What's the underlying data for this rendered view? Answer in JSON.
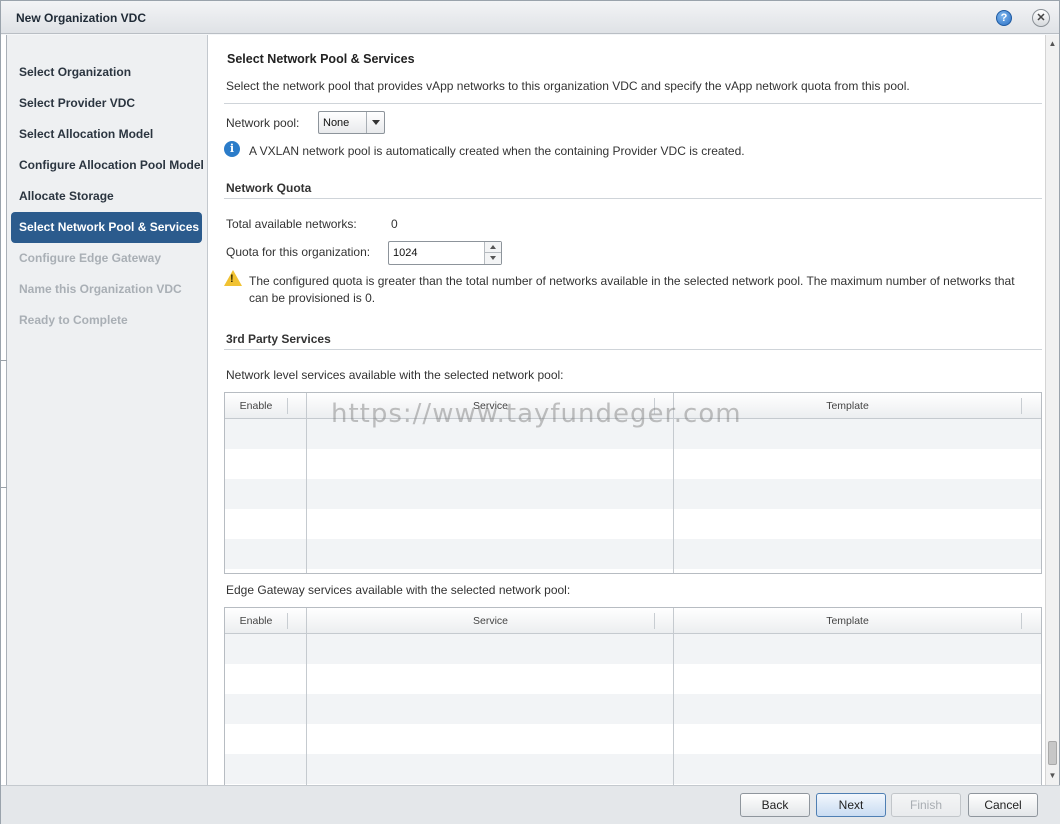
{
  "window": {
    "title": "New Organization VDC",
    "help_icon": "?",
    "close_icon": "✕"
  },
  "steps": [
    {
      "label": "Select Organization",
      "state": "done"
    },
    {
      "label": "Select Provider VDC",
      "state": "done"
    },
    {
      "label": "Select Allocation Model",
      "state": "done"
    },
    {
      "label": "Configure Allocation Pool Model",
      "state": "done"
    },
    {
      "label": "Allocate Storage",
      "state": "done"
    },
    {
      "label": "Select Network Pool & Services",
      "state": "active"
    },
    {
      "label": "Configure Edge Gateway",
      "state": "disabled"
    },
    {
      "label": "Name this Organization VDC",
      "state": "disabled"
    },
    {
      "label": "Ready to Complete",
      "state": "disabled"
    }
  ],
  "page": {
    "heading": "Select Network Pool & Services",
    "description": "Select the network pool that provides vApp networks to this organization VDC and specify the vApp network quota from this pool."
  },
  "network_pool": {
    "label": "Network pool:",
    "selected": "None",
    "info_text": "A VXLAN network pool is automatically created when the containing Provider VDC is created."
  },
  "quota": {
    "section_title": "Network Quota",
    "total_label": "Total available networks:",
    "total_value": "0",
    "quota_label": "Quota for this organization:",
    "quota_value": "1024",
    "warning_line1": "The configured quota is greater than the total number of networks available in the selected network pool.  The maximum number of networks that",
    "warning_line2": "can be provisioned is 0."
  },
  "services": {
    "section_title": "3rd Party Services",
    "network_label": "Network level services available with the selected network pool:",
    "network_columns": [
      "Enable",
      "Service",
      "Template"
    ],
    "edge_label": "Edge Gateway services available with the selected network pool:",
    "edge_columns": [
      "Enable",
      "Service",
      "Template"
    ]
  },
  "watermark": "https://www.tayfundeger.com",
  "footer": {
    "back": "Back",
    "next": "Next",
    "finish": "Finish",
    "cancel": "Cancel"
  },
  "colors": {
    "active_step": "#2b5b8d",
    "info": "#2b7cc9",
    "warning": "#f1c232"
  }
}
